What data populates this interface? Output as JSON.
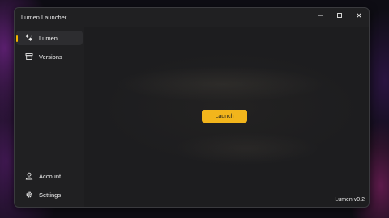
{
  "window": {
    "title": "Lumen Launcher"
  },
  "sidebar": {
    "items": [
      {
        "label": "Lumen",
        "icon": "lumen-logo-icon",
        "active": true
      },
      {
        "label": "Versions",
        "icon": "archive-icon",
        "active": false
      }
    ],
    "footer_items": [
      {
        "label": "Account",
        "icon": "person-icon"
      },
      {
        "label": "Settings",
        "icon": "gear-icon"
      }
    ]
  },
  "main": {
    "launch_label": "Launch",
    "version": "Lumen v0.2"
  },
  "colors": {
    "accent": "#f2b51c",
    "window_bg": "#202022",
    "active_item_bg": "#2d2d30"
  }
}
